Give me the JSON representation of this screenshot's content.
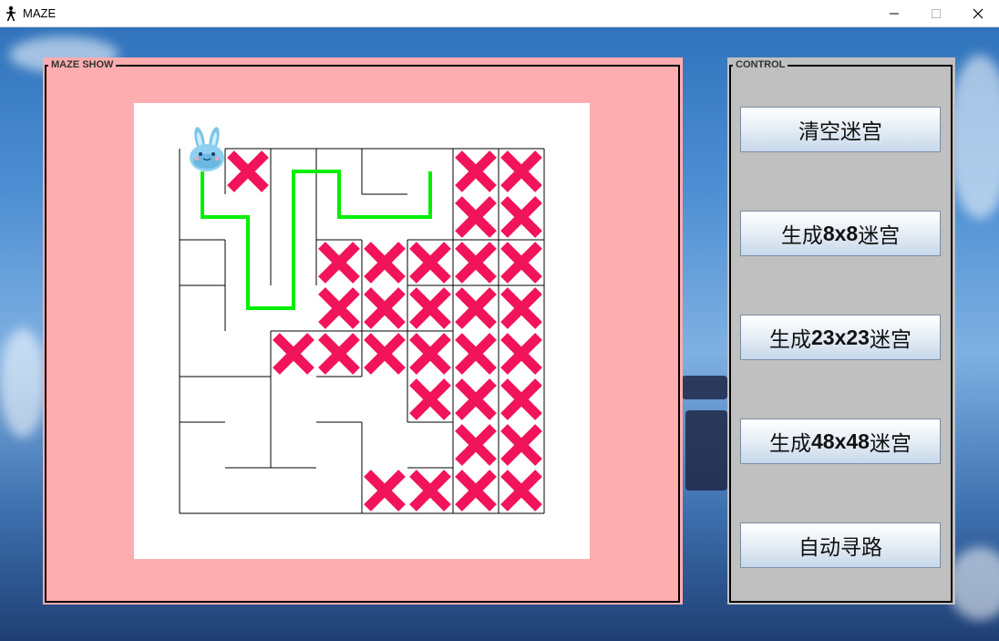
{
  "window": {
    "title": "MAZE",
    "minimize_icon": "minimize-icon",
    "maximize_icon": "maximize-icon",
    "close_icon": "close-icon"
  },
  "maze_panel": {
    "legend": "MAZE SHOW",
    "background_color": "#fdadb0"
  },
  "control_panel": {
    "legend": "CONTROL",
    "background_color": "#c0c0c0",
    "buttons": [
      {
        "id": "clear",
        "label": "清空迷宫"
      },
      {
        "id": "gen8",
        "prefix": "生成",
        "size": "8x8",
        "suffix": "迷宫"
      },
      {
        "id": "gen23",
        "prefix": "生成",
        "size": "23x23",
        "suffix": "迷宫"
      },
      {
        "id": "gen48",
        "prefix": "生成",
        "size": "48x48",
        "suffix": "迷宫"
      },
      {
        "id": "auto",
        "label": "自动寻路"
      }
    ]
  },
  "maze": {
    "rows": 8,
    "cols": 8,
    "player_icon": "bunny-icon",
    "visited_mark_icon": "cross-icon",
    "path_color": "#00ee00",
    "mark_color": "#f2145a",
    "wall_color": "#000000",
    "visited_cells": [
      [
        0,
        1
      ],
      [
        0,
        6
      ],
      [
        0,
        7
      ],
      [
        1,
        6
      ],
      [
        1,
        7
      ],
      [
        2,
        3
      ],
      [
        2,
        4
      ],
      [
        2,
        5
      ],
      [
        2,
        6
      ],
      [
        2,
        7
      ],
      [
        3,
        3
      ],
      [
        3,
        4
      ],
      [
        3,
        5
      ],
      [
        3,
        6
      ],
      [
        3,
        7
      ],
      [
        4,
        2
      ],
      [
        4,
        3
      ],
      [
        4,
        4
      ],
      [
        4,
        5
      ],
      [
        4,
        6
      ],
      [
        4,
        7
      ],
      [
        5,
        5
      ],
      [
        5,
        6
      ],
      [
        5,
        7
      ],
      [
        6,
        6
      ],
      [
        6,
        7
      ],
      [
        7,
        4
      ],
      [
        7,
        5
      ],
      [
        7,
        6
      ],
      [
        7,
        7
      ]
    ],
    "path_cells": [
      [
        0,
        0
      ],
      [
        1,
        0
      ],
      [
        1,
        1
      ],
      [
        2,
        1
      ],
      [
        3,
        1
      ],
      [
        3,
        2
      ],
      [
        2,
        2
      ],
      [
        1,
        2
      ],
      [
        0,
        2
      ],
      [
        0,
        3
      ],
      [
        1,
        3
      ],
      [
        1,
        4
      ],
      [
        1,
        5
      ],
      [
        0,
        5
      ]
    ]
  }
}
